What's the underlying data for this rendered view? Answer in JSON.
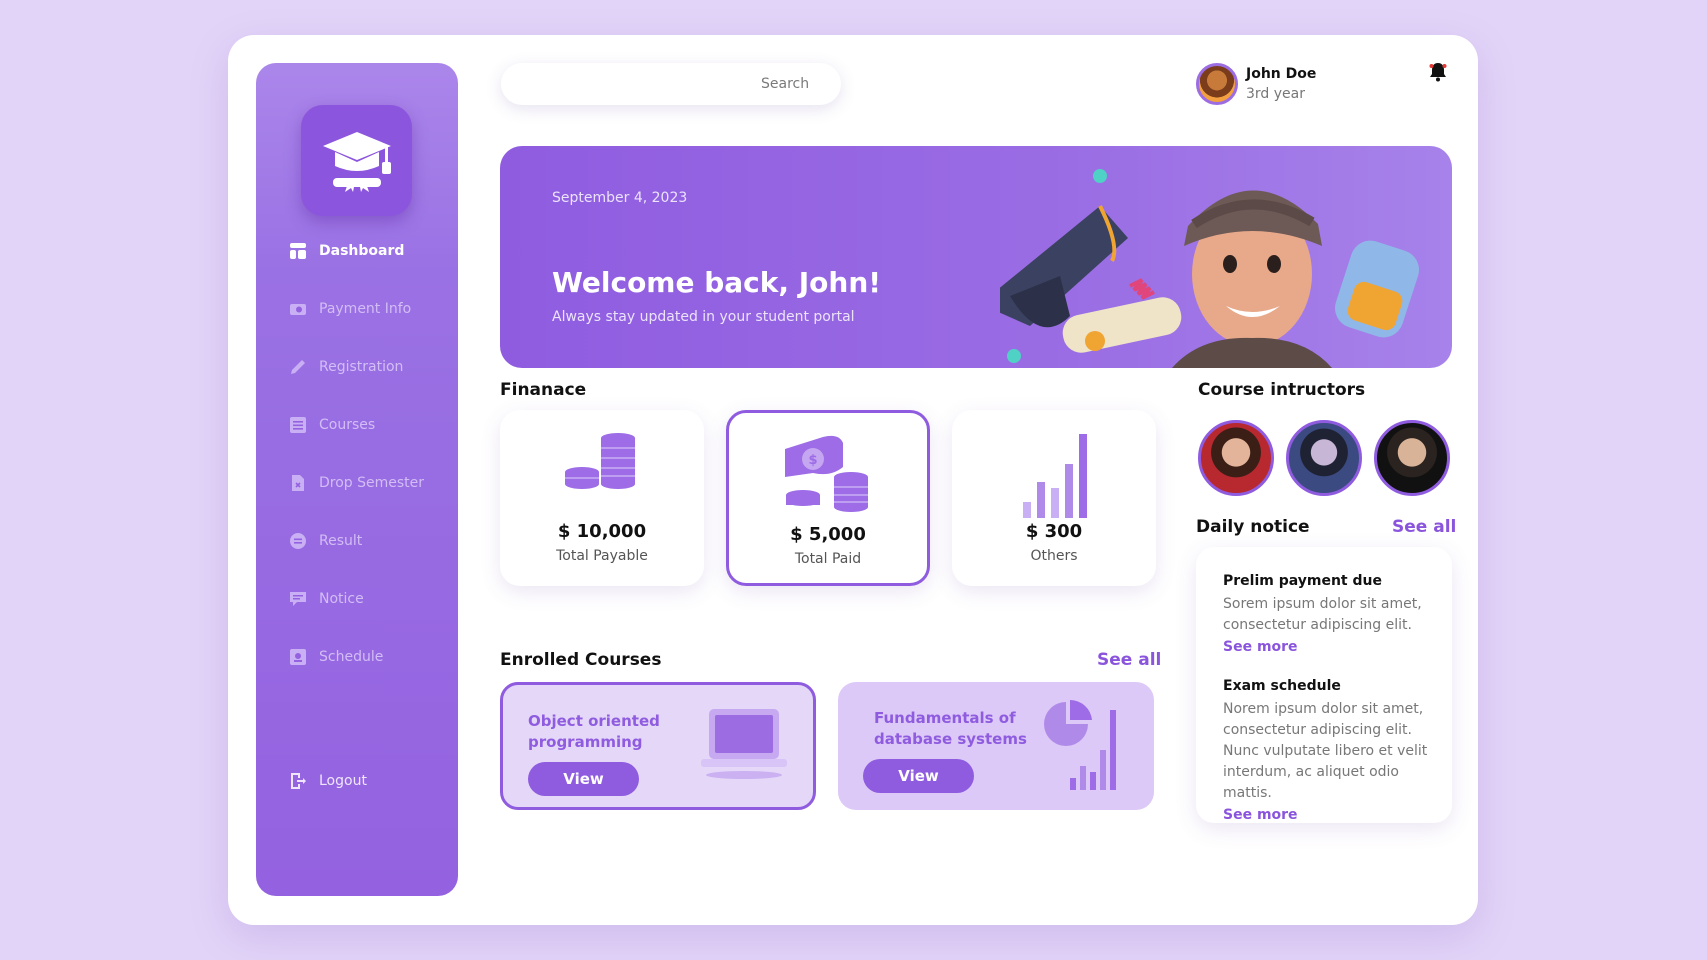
{
  "sidebar": {
    "items": [
      {
        "label": "Dashboard",
        "icon": "dashboard-icon",
        "active": true
      },
      {
        "label": "Payment Info",
        "icon": "payment-icon"
      },
      {
        "label": "Registration",
        "icon": "pencil-icon"
      },
      {
        "label": "Courses",
        "icon": "courses-icon"
      },
      {
        "label": "Drop Semester",
        "icon": "drop-file-icon"
      },
      {
        "label": "Result",
        "icon": "result-icon"
      },
      {
        "label": "Notice",
        "icon": "notice-icon"
      },
      {
        "label": "Schedule",
        "icon": "schedule-icon"
      }
    ],
    "logout": "Logout"
  },
  "search": {
    "placeholder": "Search"
  },
  "profile": {
    "name": "John Doe",
    "year": "3rd year"
  },
  "banner": {
    "date": "September 4,  2023",
    "title": "Welcome back, John!",
    "subtitle": "Always stay updated in your student portal"
  },
  "finance": {
    "heading": "Finanace",
    "cards": [
      {
        "amount": "$ 10,000",
        "label": "Total Payable"
      },
      {
        "amount": "$ 5,000",
        "label": "Total Paid"
      },
      {
        "amount": "$ 300",
        "label": "Others"
      }
    ]
  },
  "courses": {
    "heading": "Enrolled Courses",
    "see_all": "See all",
    "items": [
      {
        "title": "Object oriented programming",
        "button": "View"
      },
      {
        "title": "Fundamentals of database systems",
        "button": "View"
      }
    ]
  },
  "instructors": {
    "heading": "Course intructors"
  },
  "notices": {
    "heading": "Daily notice",
    "see_all": "See all",
    "items": [
      {
        "title": "Prelim payment due",
        "body": "Sorem ipsum dolor sit amet, consectetur adipiscing elit.",
        "more": "See more"
      },
      {
        "title": "Exam schedule",
        "body": "Norem ipsum dolor sit amet, consectetur adipiscing elit. Nunc vulputate libero et velit interdum, ac aliquet odio mattis.",
        "more": "See more"
      }
    ]
  },
  "colors": {
    "accent": "#8f5ce0",
    "background": "#e2d4f8",
    "sidebar": "#9462e0"
  }
}
